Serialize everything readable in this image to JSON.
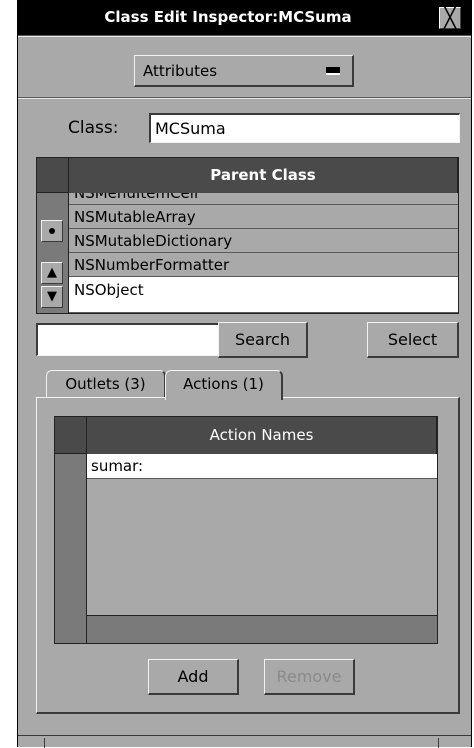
{
  "window": {
    "title": "Class Edit Inspector:MCSuma",
    "close_glyph": "╳"
  },
  "popup": {
    "selected": "Attributes",
    "icon": "popup-arrow-icon"
  },
  "class_field": {
    "label": "Class:",
    "value": "MCSuma"
  },
  "parent_browser": {
    "header": "Parent Class",
    "items": [
      "NSMenuItemCell",
      "NSMutableArray",
      "NSMutableDictionary",
      "NSNumberFormatter",
      "NSObject"
    ],
    "selected_index": 4
  },
  "search": {
    "value": "",
    "button_label": "Search",
    "select_label": "Select"
  },
  "tabs": [
    {
      "label": "Outlets (3)"
    },
    {
      "label": "Actions (1)"
    }
  ],
  "actions_table": {
    "header": "Action Names",
    "rows": [
      "sumar:"
    ]
  },
  "buttons": {
    "add": "Add",
    "remove": "Remove"
  },
  "colors": {
    "window_bg": "#a9a9a9",
    "titlebar": "#000000",
    "header_bg": "#4a4a4a",
    "disabled_text": "#8a8a8a"
  }
}
